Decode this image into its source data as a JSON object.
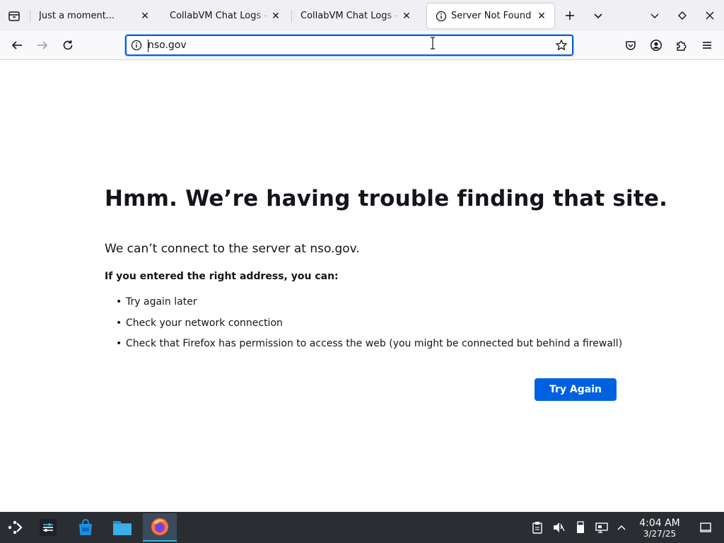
{
  "tabs": [
    {
      "title": "Just a moment...",
      "active": false
    },
    {
      "title": "CollabVM Chat Logs - Elite",
      "active": false
    },
    {
      "title": "CollabVM Chat Logs - Elite",
      "active": false
    },
    {
      "title": "Server Not Found",
      "active": true
    }
  ],
  "address_bar": {
    "value": "nso.gov"
  },
  "error_page": {
    "title": "Hmm. We’re having trouble finding that site.",
    "short_desc": "We can’t connect to the server at nso.gov.",
    "lead": "If you entered the right address, you can:",
    "suggestions": [
      "Try again later",
      "Check your network connection",
      "Check that Firefox has permission to access the web (you might be connected but behind a firewall)"
    ],
    "try_again_label": "Try Again"
  },
  "taskbar": {
    "clock_time": "4:04 AM",
    "clock_date": "3/27/25"
  },
  "colors": {
    "accent": "#0061e0",
    "taskbar_bg": "#2a2e32",
    "tab_strip_bg": "#f0f0f4"
  }
}
